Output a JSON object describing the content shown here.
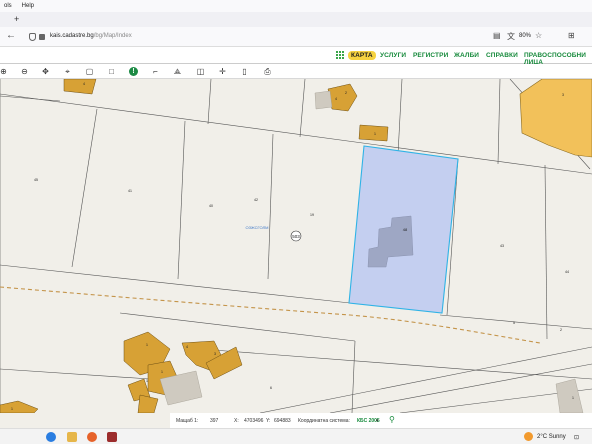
{
  "browser": {
    "menu": [
      "ols",
      "Help"
    ],
    "url_host": "kais.cadastre.bg",
    "url_path": "/bg/Map/Index",
    "zoom": "80%"
  },
  "sitenav": {
    "items": [
      {
        "label": "КАРТА",
        "active": true
      },
      {
        "label": "УСЛУГИ",
        "active": false
      },
      {
        "label": "РЕГИСТРИ",
        "active": false
      },
      {
        "label": "ЖАЛБИ",
        "active": false
      },
      {
        "label": "СПРАВКИ",
        "active": false
      },
      {
        "label": "ПРАВОСПОСОБНИ ЛИЦА",
        "active": false
      }
    ]
  },
  "toolbar": {
    "tools": [
      "zoom-in-icon",
      "zoom-out-icon",
      "pan-icon",
      "marker-icon",
      "select-rect-icon",
      "square-icon",
      "info-icon",
      "measure-line-icon",
      "measure-area-icon",
      "layers-icon",
      "crosshair-icon",
      "document-icon",
      "print-icon"
    ]
  },
  "map": {
    "parcel_numbers": [
      "4",
      "2",
      "1",
      "3",
      "4",
      "45",
      "41",
      "40",
      "42",
      "19",
      "43",
      "44",
      "1",
      "4",
      "3",
      "1",
      "1",
      "5",
      "6",
      "1",
      "2",
      "1"
    ],
    "locality_label": "ОЗЖСГОЛМ",
    "street_badge": "503",
    "selected_parcel_label": "48"
  },
  "status": {
    "scale_label": "Мащаб 1:",
    "scale_value": "397",
    "x_label": "X:",
    "x_value": "4703496",
    "y_label": "Y:",
    "y_value": "694883",
    "crs_label": "Координатна система:",
    "crs_value": "КБС 2005"
  },
  "taskbar": {
    "weather": "2°C  Sunny"
  },
  "colors": {
    "selected_parcel_fill": "#c4cff0",
    "selected_parcel_stroke": "#2fb3e6",
    "building_fill": "#d7a135",
    "building_large_fill": "#f2c15a",
    "map_bg": "#f1efe9",
    "nav_green": "#178a3c",
    "nav_active_bg": "#f6d240"
  }
}
